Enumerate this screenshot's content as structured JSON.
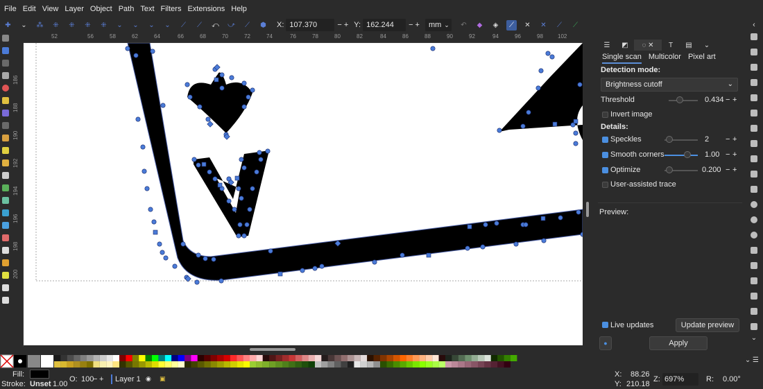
{
  "menu": [
    "File",
    "Edit",
    "View",
    "Layer",
    "Object",
    "Path",
    "Text",
    "Filters",
    "Extensions",
    "Help"
  ],
  "toolbar": {
    "x_label": "X:",
    "x_value": "107.370",
    "y_label": "Y:",
    "y_value": "162.244",
    "unit": "mm",
    "minus": "−",
    "plus": "+"
  },
  "ruler": {
    "top": [
      "52",
      "56",
      "58",
      "60",
      "62",
      "64",
      "66",
      "68",
      "70",
      "72",
      "74",
      "76",
      "78",
      "80",
      "82",
      "84",
      "86",
      "88",
      "90",
      "92",
      "94",
      "96",
      "98",
      "100",
      "102",
      "104"
    ],
    "left": [
      "186",
      "188",
      "190",
      "192",
      "194",
      "196",
      "198",
      "200",
      "202",
      "204"
    ]
  },
  "trace": {
    "tabs": {
      "single": "Single scan",
      "multi": "Multicolor",
      "pixel": "Pixel art"
    },
    "detection_label": "Detection mode:",
    "mode": "Brightness cutoff",
    "threshold_label": "Threshold",
    "threshold_value": "0.434",
    "invert_label": "Invert image",
    "details_label": "Details:",
    "speckles_label": "Speckles",
    "speckles_value": "2",
    "smooth_label": "Smooth corners",
    "smooth_value": "1.00",
    "optimize_label": "Optimize",
    "optimize_value": "0.200",
    "assisted_label": "User-assisted trace",
    "preview_label": "Preview:",
    "live_label": "Live updates",
    "update_button": "Update preview",
    "apply_button": "Apply"
  },
  "status": {
    "fill_label": "Fill:",
    "stroke_label": "Stroke:",
    "stroke_value": "Unset",
    "stroke_width": "1.00",
    "opacity_label": "O:",
    "opacity_value": "100",
    "layer": "Layer 1",
    "cursor_x_label": "X:",
    "cursor_x": "88.26",
    "cursor_y_label": "Y:",
    "cursor_y": "210.18",
    "zoom_label": "Z:",
    "zoom": "697%",
    "rotation_label": "R:",
    "rotation": "0.00°"
  },
  "colors": {
    "accent": "#4a7bd8",
    "panel_bg": "#2b2b2b",
    "canvas_bg": "#ffffff",
    "node": "#4a7bd8",
    "shape": "#000000"
  }
}
